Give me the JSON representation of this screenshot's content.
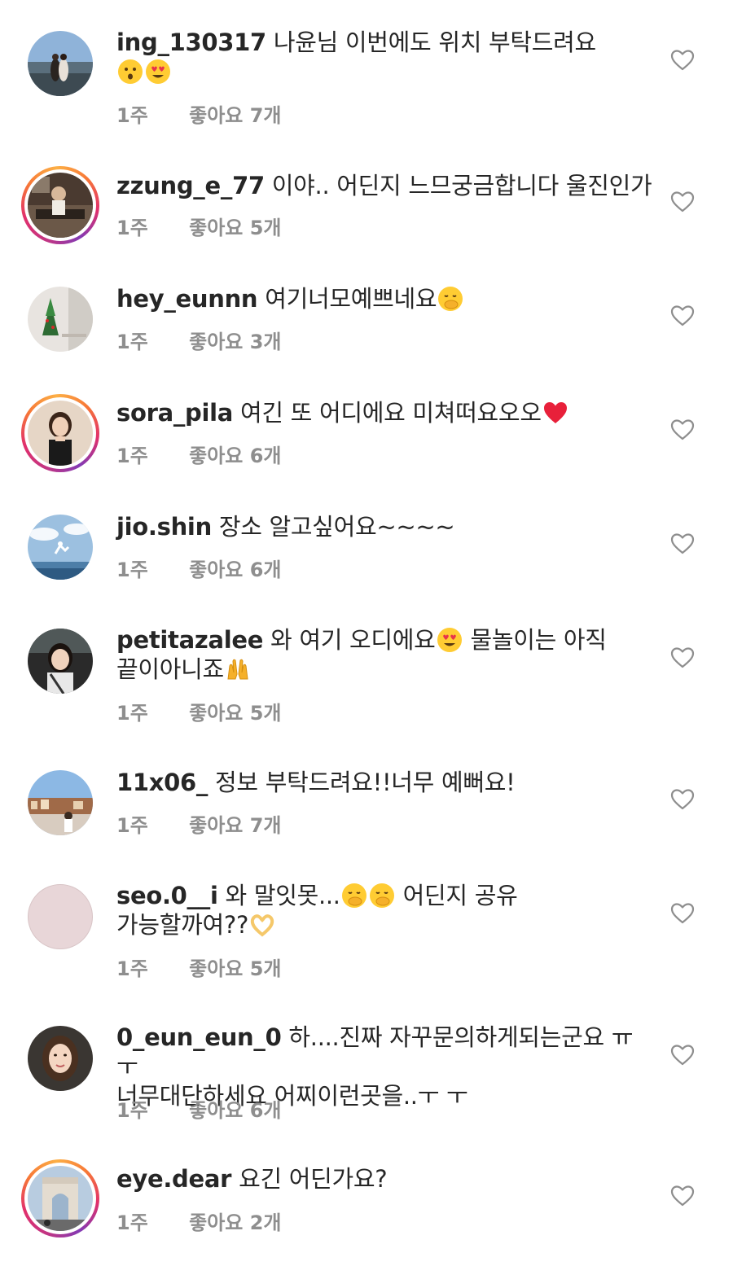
{
  "comments": [
    {
      "username": "ing_130317",
      "text": "나윤님 이번에도 위치 부탁드려요",
      "emojis_after": [
        "hushed-face-emoji",
        "heart-eyes-emoji"
      ],
      "emojis_on_new_line": true,
      "time": "1주",
      "likes": "좋아요 7개",
      "story_ring": false,
      "avatar": "couple-at-mountain-view"
    },
    {
      "username": "zzung_e_77",
      "text": "이야.. 어딘지 느므궁금합니다 울진인가",
      "time": "1주",
      "likes": "좋아요 5개",
      "story_ring": true,
      "avatar": "person-at-dining-table"
    },
    {
      "username": "hey_eunnn",
      "text": "여기너모예쁘네요",
      "emoji_inline": "hand-over-mouth-emoji",
      "time": "1주",
      "likes": "좋아요 3개",
      "story_ring": false,
      "avatar": "christmas-tree-cafe"
    },
    {
      "username": "sora_pila",
      "text": "여긴 또 어디에요 미쳐떠요오오",
      "emoji_inline": "red-heart-emoji",
      "time": "1주",
      "likes": "좋아요 6개",
      "story_ring": true,
      "avatar": "woman-portrait"
    },
    {
      "username": "jio.shin",
      "text": "장소 알고싶어요~~~~",
      "time": "1주",
      "likes": "좋아요 6개",
      "story_ring": false,
      "avatar": "jumping-on-beach"
    },
    {
      "username": "petitazalee",
      "text": "와 여기 오디에요",
      "emoji_inline": "heart-eyes-emoji",
      "text2": "물놀이는 아직",
      "line2": "끝이아니죠",
      "emoji_line2": "raising-hands-emoji",
      "time": "1주",
      "likes": "좋아요 5개",
      "story_ring": false,
      "avatar": "woman-in-car"
    },
    {
      "username": "11x06_",
      "text": "정보 부탁드려요!!너무 예뻐요!",
      "time": "1주",
      "likes": "좋아요 7개",
      "story_ring": false,
      "avatar": "seaside-town"
    },
    {
      "username": "seo.0__i",
      "text": "와 말잇못...",
      "emojis_inline": [
        "hand-over-mouth-emoji",
        "hand-over-mouth-emoji"
      ],
      "text2": "어딘지 공유",
      "line2": "가능할까여??",
      "emoji_line2": "heart-hands-emoji",
      "time": "1주",
      "likes": "좋아요 5개",
      "story_ring": false,
      "avatar": "plain-pink"
    },
    {
      "username": "0_eun_eun_0",
      "text": "하....진짜 자꾸문의하게되는군요 ㅠㅜ",
      "line2": "너무대단하세요 어찌이런곳을..ㅜ ㅜ",
      "time": "1주",
      "likes": "좋아요 6개",
      "story_ring": false,
      "avatar": "woman-selfie"
    },
    {
      "username": "eye.dear",
      "text": "요긴 어딘가요?",
      "time": "1주",
      "likes": "좋아요 2개",
      "story_ring": true,
      "avatar": "arc-de-triomphe"
    }
  ],
  "colors": {
    "text": "#262626",
    "meta": "#8e8e8e",
    "heart_outline": "#8e8e8e"
  }
}
